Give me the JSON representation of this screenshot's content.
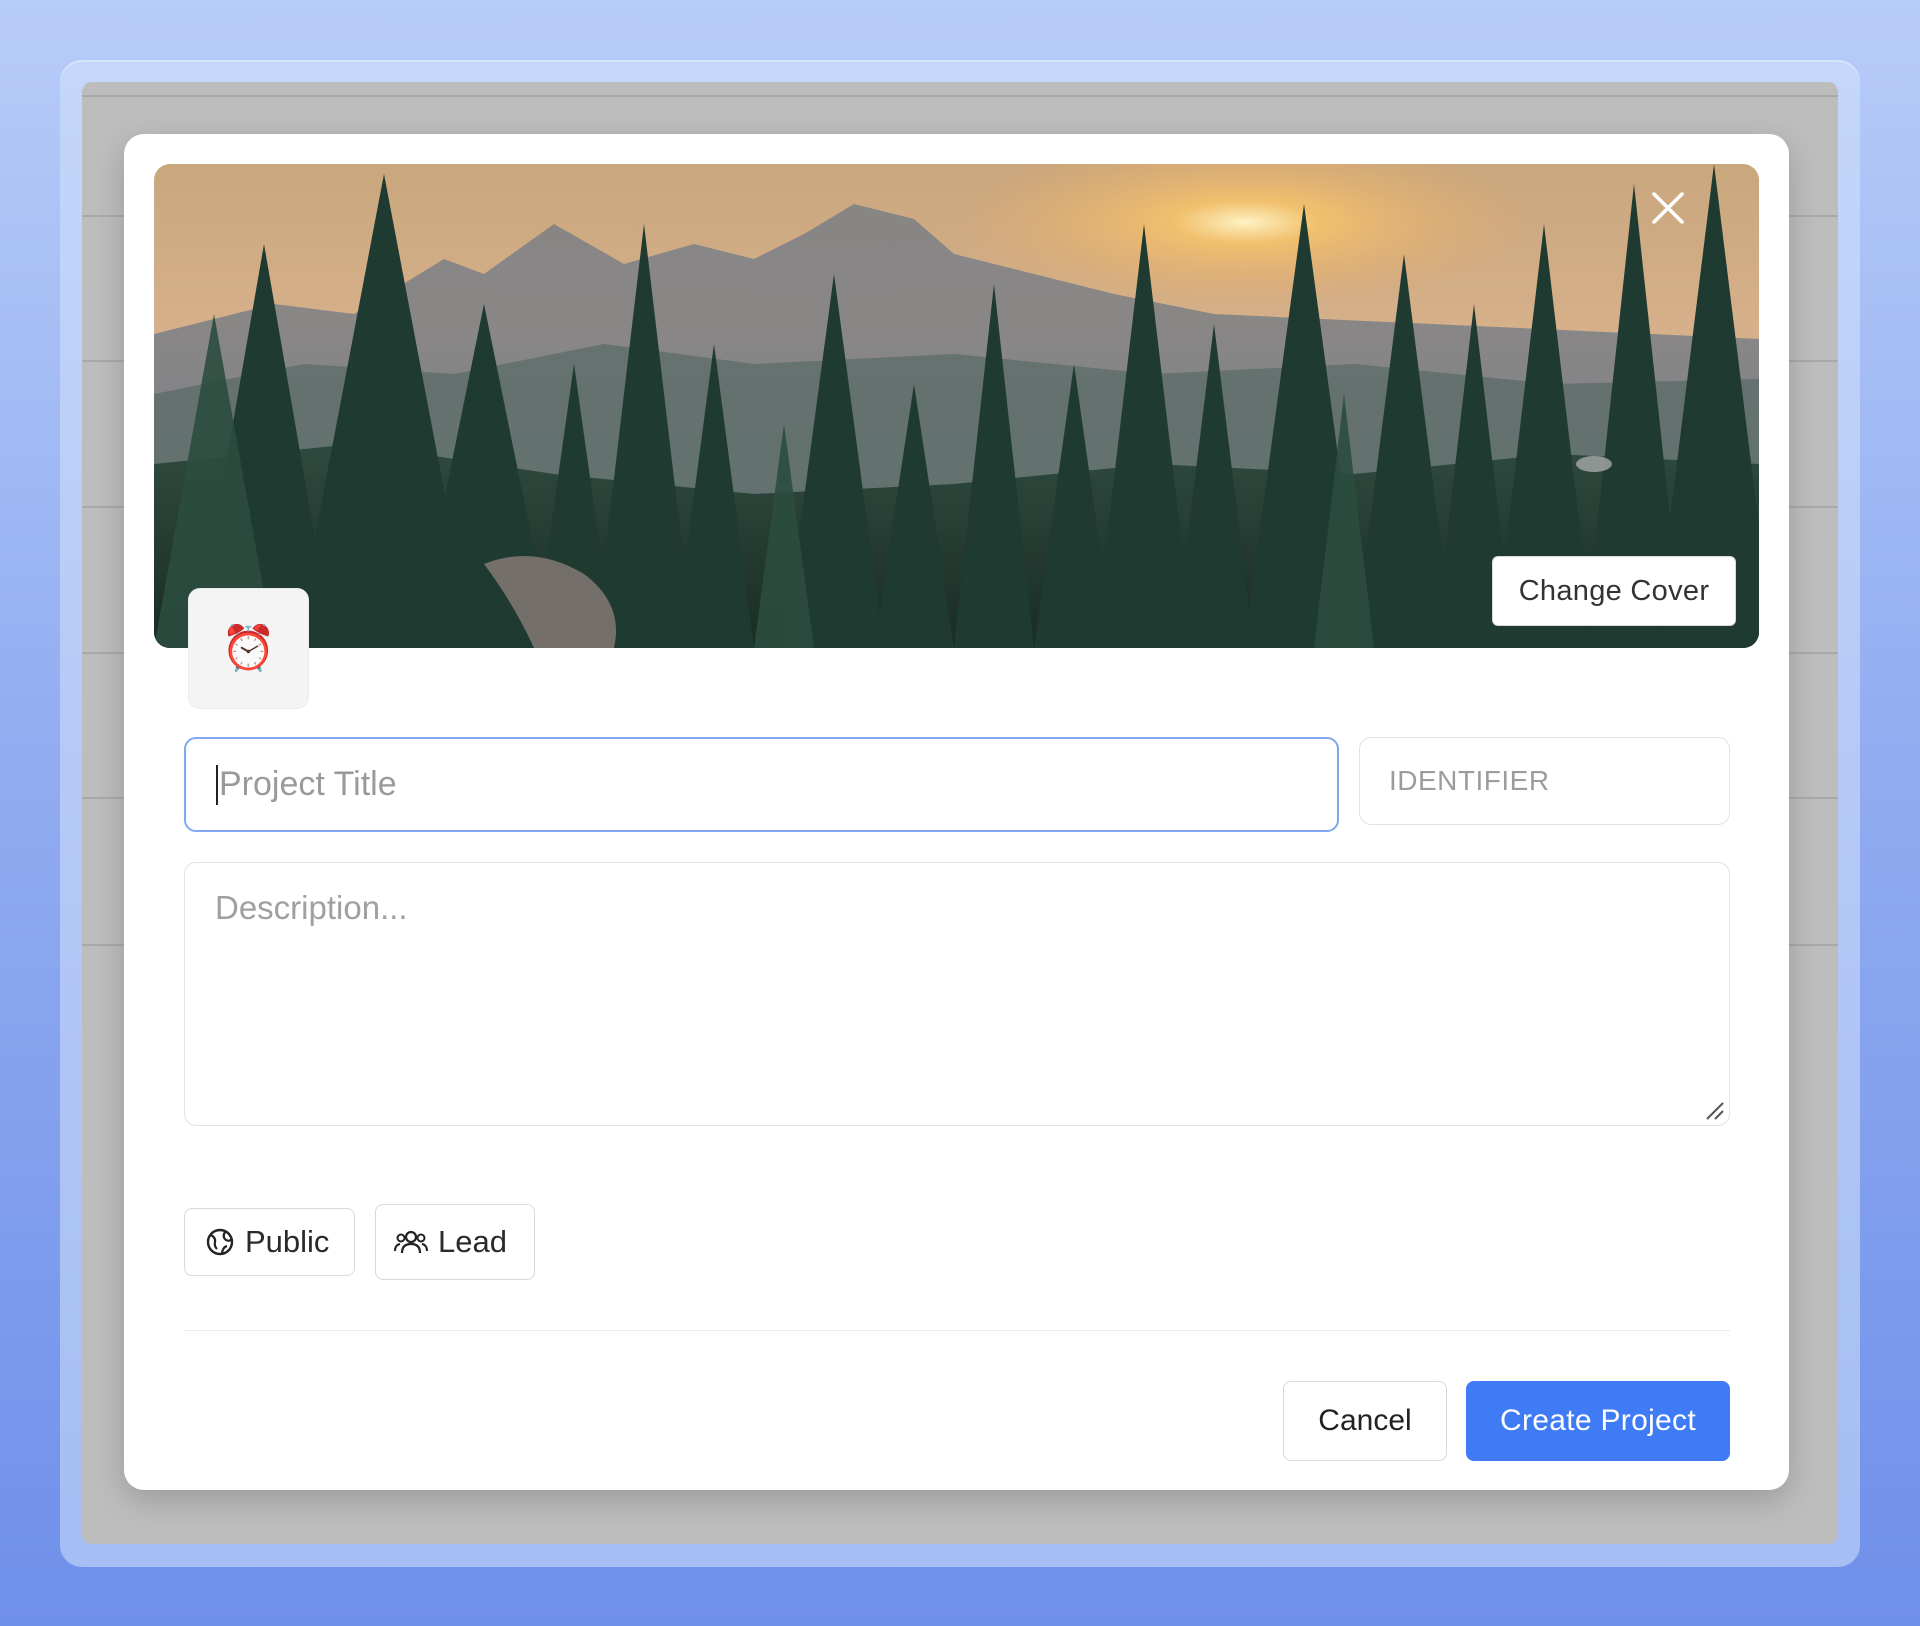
{
  "modal": {
    "cover": {
      "change_cover_label": "Change Cover",
      "close_icon": "close-icon"
    },
    "emoji": {
      "value": "⏰",
      "icon": "alarm-clock-icon"
    },
    "fields": {
      "title_placeholder": "Project Title",
      "title_value": "",
      "identifier_placeholder": "IDENTIFIER",
      "identifier_value": "",
      "description_placeholder": "Description...",
      "description_value": ""
    },
    "chips": {
      "public_label": "Public",
      "public_icon": "globe-icon",
      "lead_label": "Lead",
      "lead_icon": "users-icon"
    },
    "footer": {
      "cancel_label": "Cancel",
      "create_label": "Create Project"
    }
  },
  "colors": {
    "primary": "#3e7bf4",
    "focus_border": "#7fa8ee",
    "background_top": "#b7ccf8",
    "background_bottom": "#6f90ea"
  }
}
